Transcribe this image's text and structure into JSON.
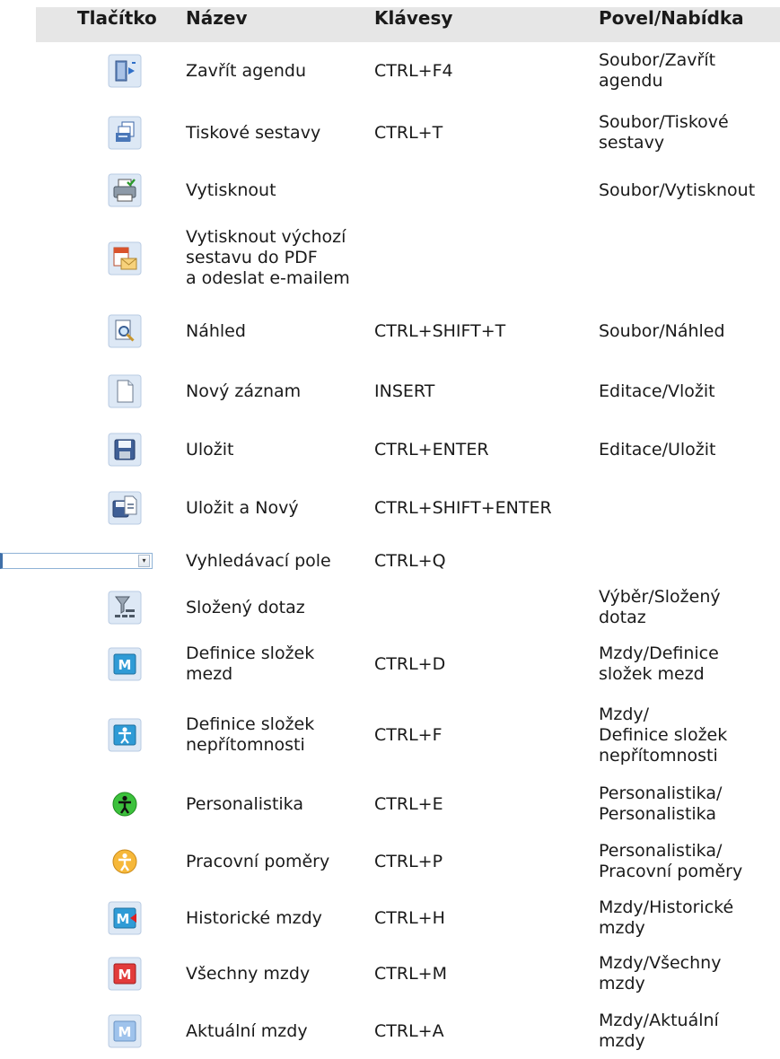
{
  "header": {
    "col_button": "Tlačítko",
    "col_name": "Název",
    "col_keys": "Klávesy",
    "col_command": "Povel/Nabídka"
  },
  "rows": [
    {
      "icon": "close-agenda-icon",
      "name": "Zavřít agendu",
      "keys": "CTRL+F4",
      "command": "Soubor/Zavřít\nagendu"
    },
    {
      "icon": "print-reports-icon",
      "name": "Tiskové sestavy",
      "keys": "CTRL+T",
      "command": "Soubor/Tiskové\nsestavy"
    },
    {
      "icon": "printer-icon",
      "name": "Vytisknout",
      "keys": "",
      "command": "Soubor/Vytisknout"
    },
    {
      "icon": "pdf-email-icon",
      "name": "Vytisknout výchozí\nsestavu do PDF\na odeslat e-mailem",
      "keys": "",
      "command": ""
    },
    {
      "icon": "preview-icon",
      "name": "Náhled",
      "keys": "CTRL+SHIFT+T",
      "command": "Soubor/Náhled"
    },
    {
      "icon": "new-record-icon",
      "name": "Nový záznam",
      "keys": "INSERT",
      "command": "Editace/Vložit"
    },
    {
      "icon": "save-icon",
      "name": "Uložit",
      "keys": "CTRL+ENTER",
      "command": "Editace/Uložit"
    },
    {
      "icon": "save-new-icon",
      "name": "Uložit a Nový",
      "keys": "CTRL+SHIFT+ENTER",
      "command": ""
    },
    {
      "icon": "search-field-dropdown",
      "name": "Vyhledávací pole",
      "keys": "CTRL+Q",
      "command": ""
    },
    {
      "icon": "compound-query-icon",
      "name": "Složený dotaz",
      "keys": "",
      "command": "Výběr/Složený\ndotaz"
    },
    {
      "icon": "payroll-components-icon",
      "name": "Definice složek\nmezd",
      "keys": "CTRL+D",
      "command": "Mzdy/Definice\nsložek mezd"
    },
    {
      "icon": "absence-components-icon",
      "name": "Definice složek\nnepřítomnosti",
      "keys": "CTRL+F",
      "command": "Mzdy/\nDefinice složek\nnepřítomnosti"
    },
    {
      "icon": "personnel-icon",
      "name": "Personalistika",
      "keys": "CTRL+E",
      "command": "Personalistika/\nPersonalistika"
    },
    {
      "icon": "employment-icon",
      "name": "Pracovní poměry",
      "keys": "CTRL+P",
      "command": "Personalistika/\nPracovní poměry"
    },
    {
      "icon": "historic-payroll-icon",
      "name": "Historické mzdy",
      "keys": "CTRL+H",
      "command": "Mzdy/Historické\nmzdy"
    },
    {
      "icon": "all-payroll-icon",
      "name": "Všechny mzdy",
      "keys": "CTRL+M",
      "command": "Mzdy/Všechny\nmzdy"
    },
    {
      "icon": "current-payroll-icon",
      "name": "Aktuální mzdy",
      "keys": "CTRL+A",
      "command": "Mzdy/Aktuální\nmzdy"
    }
  ]
}
